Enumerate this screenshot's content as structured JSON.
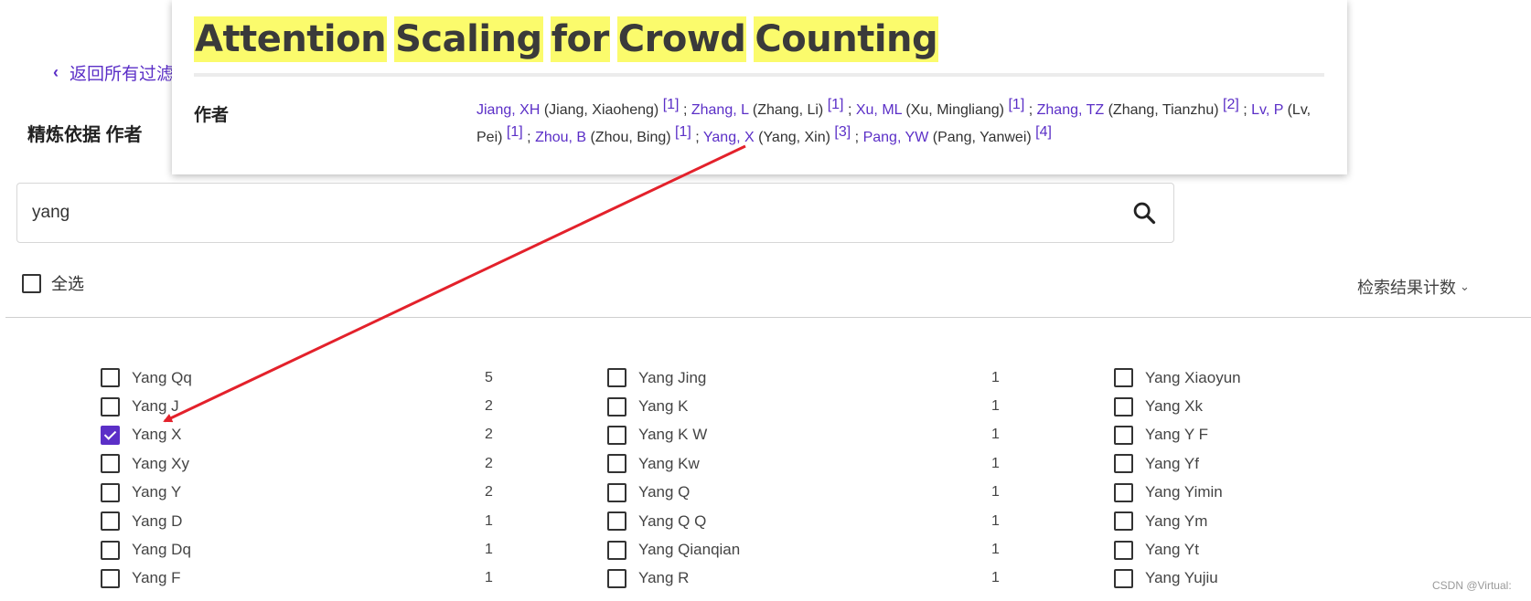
{
  "back_link": {
    "label": "返回所有过滤"
  },
  "refine": {
    "title": "精炼依据 作者"
  },
  "search": {
    "value": "yang",
    "icon": "search-icon"
  },
  "select_all": {
    "label": "全选"
  },
  "sort": {
    "label": "检索结果计数"
  },
  "popup": {
    "title_words": [
      "Attention",
      "Scaling",
      "for",
      "Crowd",
      "Counting"
    ],
    "author_label": "作者",
    "authors": [
      {
        "abbr": "Jiang, XH",
        "full": "(Jiang, Xiaoheng)",
        "ref": "[1]"
      },
      {
        "abbr": "Zhang, L",
        "full": "(Zhang, Li)",
        "ref": "[1]"
      },
      {
        "abbr": "Xu, ML",
        "full": "(Xu, Mingliang)",
        "ref": "[1]"
      },
      {
        "abbr": "Zhang, TZ",
        "full": "(Zhang, Tianzhu)",
        "ref": "[2]"
      },
      {
        "abbr": "Lv, P",
        "full": "(Lv, Pei)",
        "ref": "[1]"
      },
      {
        "abbr": "Zhou, B",
        "full": "(Zhou, Bing)",
        "ref": "[1]"
      },
      {
        "abbr": "Yang, X",
        "full": "(Yang, Xin)",
        "ref": "[3]"
      },
      {
        "abbr": "Pang, YW",
        "full": "(Pang, Yanwei)",
        "ref": "[4]"
      }
    ],
    "separator": ";"
  },
  "columns": [
    [
      {
        "name": "Yang Qq",
        "count": "5",
        "checked": false
      },
      {
        "name": "Yang J",
        "count": "2",
        "checked": false
      },
      {
        "name": "Yang X",
        "count": "2",
        "checked": true
      },
      {
        "name": "Yang Xy",
        "count": "2",
        "checked": false
      },
      {
        "name": "Yang Y",
        "count": "2",
        "checked": false
      },
      {
        "name": "Yang D",
        "count": "1",
        "checked": false
      },
      {
        "name": "Yang Dq",
        "count": "1",
        "checked": false
      },
      {
        "name": "Yang F",
        "count": "1",
        "checked": false
      }
    ],
    [
      {
        "name": "Yang Jing",
        "count": "1",
        "checked": false
      },
      {
        "name": "Yang K",
        "count": "1",
        "checked": false
      },
      {
        "name": "Yang K W",
        "count": "1",
        "checked": false
      },
      {
        "name": "Yang Kw",
        "count": "1",
        "checked": false
      },
      {
        "name": "Yang Q",
        "count": "1",
        "checked": false
      },
      {
        "name": "Yang Q Q",
        "count": "1",
        "checked": false
      },
      {
        "name": "Yang Qianqian",
        "count": "1",
        "checked": false
      },
      {
        "name": "Yang R",
        "count": "1",
        "checked": false
      }
    ],
    [
      {
        "name": "Yang Xiaoyun",
        "count": "",
        "checked": false
      },
      {
        "name": "Yang Xk",
        "count": "",
        "checked": false
      },
      {
        "name": "Yang Y F",
        "count": "",
        "checked": false
      },
      {
        "name": "Yang Yf",
        "count": "",
        "checked": false
      },
      {
        "name": "Yang Yimin",
        "count": "",
        "checked": false
      },
      {
        "name": "Yang Ym",
        "count": "",
        "checked": false
      },
      {
        "name": "Yang Yt",
        "count": "",
        "checked": false
      },
      {
        "name": "Yang Yujiu",
        "count": "",
        "checked": false
      }
    ]
  ],
  "watermark": "CSDN @Virtual:",
  "colors": {
    "accent": "#5b2fc7",
    "highlight": "#fbfb6c",
    "arrow": "#e3212b"
  }
}
